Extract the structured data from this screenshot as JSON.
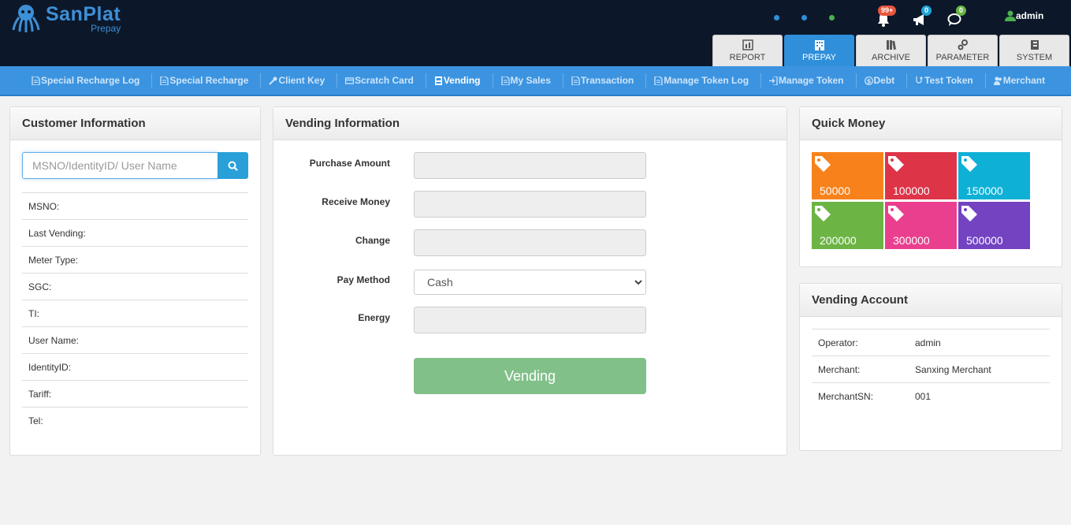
{
  "app": {
    "logo_name": "SanPlat",
    "logo_sub": "Prepay",
    "user": "admin"
  },
  "notifications": {
    "alerts": "99+",
    "announcements": "0",
    "messages": "0"
  },
  "colors": {
    "header_bg": "#0c1829",
    "accent": "#3c94e0",
    "badge_alerts": "#e8553d",
    "badge_announcements": "#22a4d8",
    "badge_messages": "#6cb444"
  },
  "module_tabs": [
    {
      "label": "REPORT",
      "icon": "report-icon"
    },
    {
      "label": "PREPAY",
      "icon": "building-icon",
      "active": true
    },
    {
      "label": "ARCHIVE",
      "icon": "books-icon"
    },
    {
      "label": "PARAMETER",
      "icon": "gears-icon"
    },
    {
      "label": "SYSTEM",
      "icon": "book-icon"
    }
  ],
  "submenu": [
    {
      "label": "Special Recharge Log",
      "icon": "document-icon"
    },
    {
      "label": "Special Recharge",
      "icon": "document-icon"
    },
    {
      "label": "Client Key",
      "icon": "key-icon"
    },
    {
      "label": "Scratch Card",
      "icon": "card-icon"
    },
    {
      "label": "Vending",
      "icon": "vending-icon",
      "active": true
    },
    {
      "label": "My Sales",
      "icon": "document-icon"
    },
    {
      "label": "Transaction",
      "icon": "document-icon"
    },
    {
      "label": "Manage Token Log",
      "icon": "document-icon"
    },
    {
      "label": "Manage Token",
      "icon": "sign-in-icon"
    },
    {
      "label": "Debt",
      "icon": "dollar-icon"
    },
    {
      "label": "Test Token",
      "icon": "stethoscope-icon"
    },
    {
      "label": "Merchant",
      "icon": "users-icon"
    }
  ],
  "customer": {
    "title": "Customer Information",
    "search_placeholder": "MSNO/IdentityID/ User Name",
    "fields": [
      "MSNO:",
      "Last Vending:",
      "Meter Type:",
      "SGC:",
      "TI:",
      "User Name:",
      "IdentityID:",
      "Tariff:",
      "Tel:"
    ]
  },
  "vending": {
    "title": "Vending Information",
    "labels": {
      "purchase_amount": "Purchase Amount",
      "receive_money": "Receive Money",
      "change": "Change",
      "pay_method": "Pay Method",
      "energy": "Energy"
    },
    "pay_method_value": "Cash",
    "button": "Vending"
  },
  "quick_money": {
    "title": "Quick Money",
    "tiles": [
      {
        "amount": "50000",
        "color": "#f7821b"
      },
      {
        "amount": "100000",
        "color": "#de3448"
      },
      {
        "amount": "150000",
        "color": "#0fb0d6"
      },
      {
        "amount": "200000",
        "color": "#6cb444"
      },
      {
        "amount": "300000",
        "color": "#ea3f8e"
      },
      {
        "amount": "500000",
        "color": "#7343c2"
      }
    ]
  },
  "account": {
    "title": "Vending Account",
    "rows": [
      {
        "key": "Operator:",
        "value": "admin"
      },
      {
        "key": "Merchant:",
        "value": "Sanxing Merchant"
      },
      {
        "key": "MerchantSN:",
        "value": "001"
      }
    ]
  }
}
